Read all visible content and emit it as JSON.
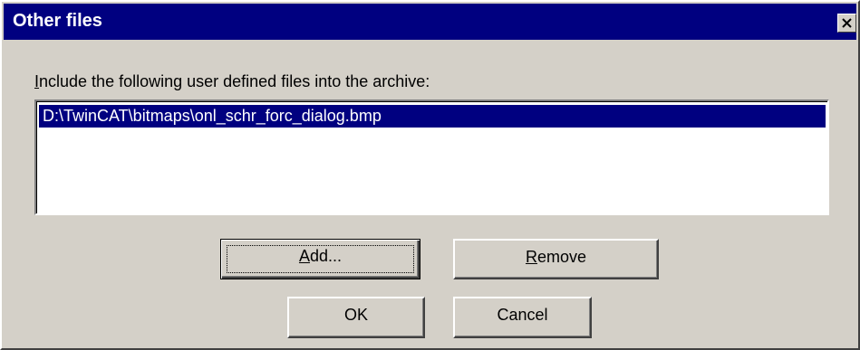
{
  "dialog": {
    "title": "Other files",
    "close_icon": "close-icon",
    "prompt_prefix": "",
    "prompt_mnemonic": "I",
    "prompt_rest": "nclude the following user defined files into the archive:",
    "files": [
      "D:\\TwinCAT\\bitmaps\\onl_schr_forc_dialog.bmp"
    ],
    "buttons": {
      "add_mnemonic": "A",
      "add_rest": "dd...",
      "remove_mnemonic": "R",
      "remove_rest": "emove",
      "ok": "OK",
      "cancel": "Cancel"
    },
    "colors": {
      "titlebar": "#000080",
      "face": "#d4d0c8",
      "selection": "#000080"
    }
  }
}
